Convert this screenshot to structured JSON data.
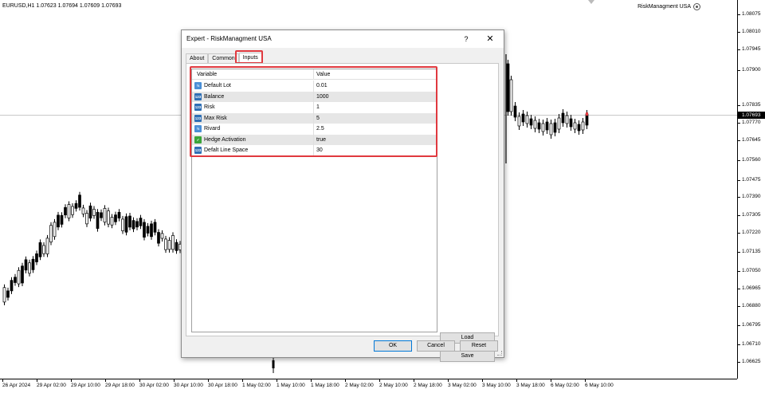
{
  "chart": {
    "symbol_label": "EURUSD,H1  1.07623 1.07694 1.07609 1.07693",
    "indicator_label": "RiskManagment USA",
    "current_price": "1.07693",
    "price_ticks": [
      "1.08075",
      "1.08010",
      "1.07945",
      "1.07900",
      "1.07835",
      "1.07770",
      "1.07645",
      "1.07560",
      "1.07475",
      "1.07390",
      "1.07305",
      "1.07220",
      "1.07135",
      "1.07050",
      "1.06965",
      "1.06880",
      "1.06795",
      "1.06710",
      "1.06625",
      "1.06455"
    ],
    "time_ticks": [
      "26 Apr 2024",
      "29 Apr 02:00",
      "29 Apr 10:00",
      "29 Apr 18:00",
      "30 Apr 02:00",
      "30 Apr 10:00",
      "30 Apr 18:00",
      "1 May 02:00",
      "1 May 10:00",
      "1 May 18:00",
      "2 May 02:00",
      "2 May 10:00",
      "2 May 18:00",
      "3 May 02:00",
      "3 May 10:00",
      "3 May 18:00",
      "6 May 02:00",
      "6 May 10:00"
    ],
    "colors": {
      "candle_up": "#ffffff",
      "candle_down": "#000000",
      "price_line": "#c8c8c8",
      "highlight": "#e0393f"
    }
  },
  "dialog": {
    "title": "Expert - RiskManagment USA",
    "help_label": "?",
    "close_label": "✕",
    "tabs": [
      {
        "label": "About",
        "active": false
      },
      {
        "label": "Common",
        "active": false
      },
      {
        "label": "Inputs",
        "active": true
      }
    ],
    "table": {
      "header_variable": "Variable",
      "header_value": "Value",
      "rows": [
        {
          "icon": "double-type-icon",
          "icon_text": "½",
          "icon_color": "#4a8fd6",
          "name": "Default Lot",
          "value": "0.01"
        },
        {
          "icon": "integer-type-icon",
          "icon_text": "123",
          "icon_color": "#2f6fb5",
          "name": "Balance",
          "value": "1000"
        },
        {
          "icon": "integer-type-icon",
          "icon_text": "123",
          "icon_color": "#2f6fb5",
          "name": "Risk",
          "value": "1"
        },
        {
          "icon": "integer-type-icon",
          "icon_text": "123",
          "icon_color": "#2f6fb5",
          "name": "Max Risk",
          "value": "5"
        },
        {
          "icon": "double-type-icon",
          "icon_text": "½",
          "icon_color": "#4a8fd6",
          "name": "Rivard",
          "value": "2.5"
        },
        {
          "icon": "bool-type-icon",
          "icon_text": "✓",
          "icon_color": "#3aa53a",
          "name": "Hedge Activation",
          "value": "true"
        },
        {
          "icon": "integer-type-icon",
          "icon_text": "123",
          "icon_color": "#2f6fb5",
          "name": "Defalt Line Space",
          "value": "30"
        }
      ]
    },
    "load_label": "Load",
    "save_label": "Save",
    "ok_label": "OK",
    "cancel_label": "Cancel",
    "reset_label": "Reset"
  }
}
